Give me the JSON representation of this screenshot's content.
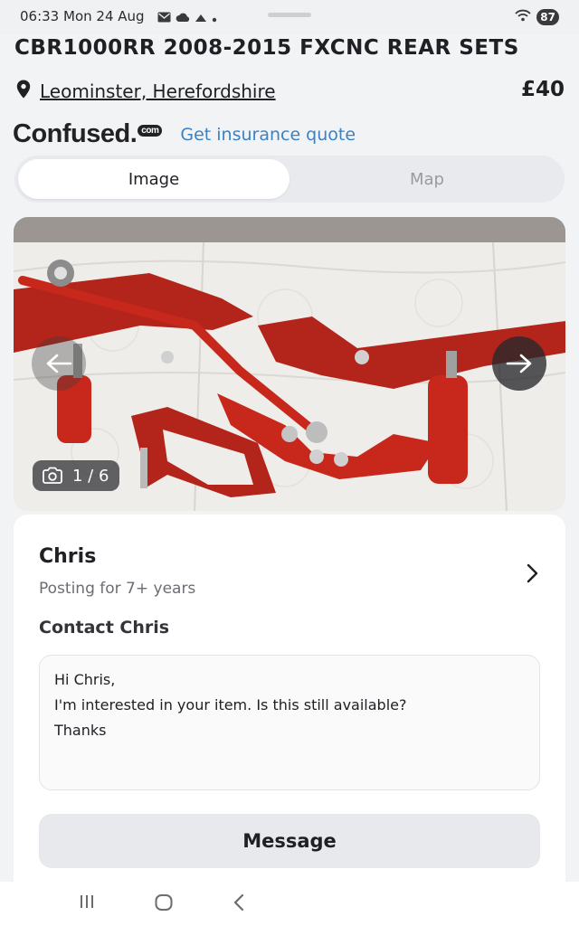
{
  "status": {
    "time": "06:33",
    "date": "Mon 24 Aug",
    "battery": "87",
    "icons": [
      "mail-icon",
      "cloud-icon",
      "cloud-icon",
      "dot-icon"
    ]
  },
  "listing": {
    "title": "CBR1000RR 2008-2015 FXCNC REAR SETS",
    "location": "Leominster, Herefordshire",
    "price": "£40"
  },
  "insurance": {
    "brand": "Confused.",
    "brand_suffix": "com",
    "link": "Get insurance quote"
  },
  "view_toggle": {
    "options": [
      "Image",
      "Map"
    ],
    "selected": "Image"
  },
  "gallery": {
    "counter": "1 / 6",
    "current": 1,
    "total": 6
  },
  "seller": {
    "name": "Chris",
    "subtitle": "Posting for 7+ years"
  },
  "contact": {
    "title": "Contact Chris",
    "message_lines": [
      "Hi Chris,",
      "I'm interested in your item. Is this still available?",
      "Thanks"
    ],
    "button": "Message"
  },
  "colors": {
    "accent_link": "#3b82c4",
    "part_red": "#c8281c",
    "background": "#f2f3f5"
  }
}
